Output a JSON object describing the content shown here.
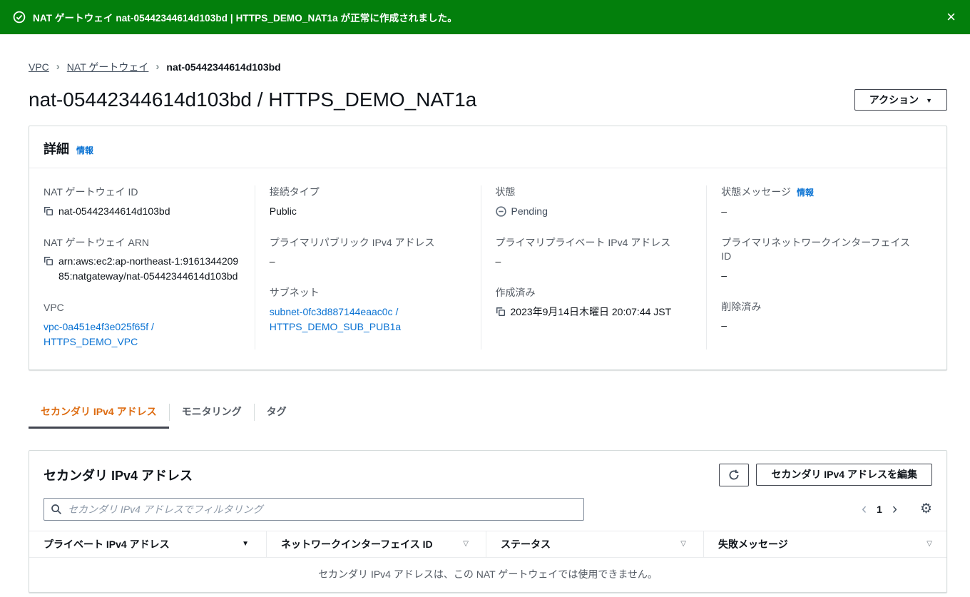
{
  "flash": {
    "message": "NAT ゲートウェイ nat-05442344614d103bd | HTTPS_DEMO_NAT1a が正常に作成されました。"
  },
  "icons": {
    "close": "×",
    "caret_down": "▼",
    "sort_desc": "▼",
    "sort_none": "▽",
    "gear": "⚙",
    "chevron_left": "‹",
    "chevron_right": "›"
  },
  "colors": {
    "success_green": "#037f0c",
    "link_blue": "#0972d3",
    "active_tab_orange": "#dd6b10"
  },
  "breadcrumb": {
    "items": [
      "VPC",
      "NAT ゲートウェイ",
      "nat-05442344614d103bd"
    ]
  },
  "page": {
    "title": "nat-05442344614d103bd / HTTPS_DEMO_NAT1a",
    "actions_label": "アクション"
  },
  "details": {
    "title": "詳細",
    "info_label": "情報",
    "fields": {
      "nat_id": {
        "label": "NAT ゲートウェイ ID",
        "value": "nat-05442344614d103bd"
      },
      "nat_arn": {
        "label": "NAT ゲートウェイ ARN",
        "value": "arn:aws:ec2:ap-northeast-1:916134420985:natgateway/nat-05442344614d103bd"
      },
      "vpc": {
        "label": "VPC",
        "value": "vpc-0a451e4f3e025f65f / HTTPS_DEMO_VPC"
      },
      "connectivity_type": {
        "label": "接続タイプ",
        "value": "Public"
      },
      "primary_public_ip": {
        "label": "プライマリパブリック IPv4 アドレス",
        "value": "–"
      },
      "subnet": {
        "label": "サブネット",
        "value": "subnet-0fc3d887144eaac0c / HTTPS_DEMO_SUB_PUB1a"
      },
      "state": {
        "label": "状態",
        "value": "Pending"
      },
      "primary_private_ip": {
        "label": "プライマリプライベート IPv4 アドレス",
        "value": "–"
      },
      "created": {
        "label": "作成済み",
        "value": "2023年9月14日木曜日 20:07:44 JST"
      },
      "state_message": {
        "label": "状態メッセージ",
        "info_label": "情報",
        "value": "–"
      },
      "primary_eni": {
        "label": "プライマリネットワークインターフェイス ID",
        "value": "–"
      },
      "deleted": {
        "label": "削除済み",
        "value": "–"
      }
    }
  },
  "tabs": {
    "items": [
      {
        "label": "セカンダリ IPv4 アドレス"
      },
      {
        "label": "モニタリング"
      },
      {
        "label": "タグ"
      }
    ]
  },
  "secondary": {
    "title": "セカンダリ IPv4 アドレス",
    "edit_button": "セカンダリ IPv4 アドレスを編集",
    "filter_placeholder": "セカンダリ IPv4 アドレスでフィルタリング",
    "page_number": "1",
    "table": {
      "headers": [
        "プライベート IPv4 アドレス",
        "ネットワークインターフェイス ID",
        "ステータス",
        "失敗メッセージ"
      ],
      "empty_message": "セカンダリ IPv4 アドレスは、この NAT ゲートウェイでは使用できません。"
    }
  }
}
